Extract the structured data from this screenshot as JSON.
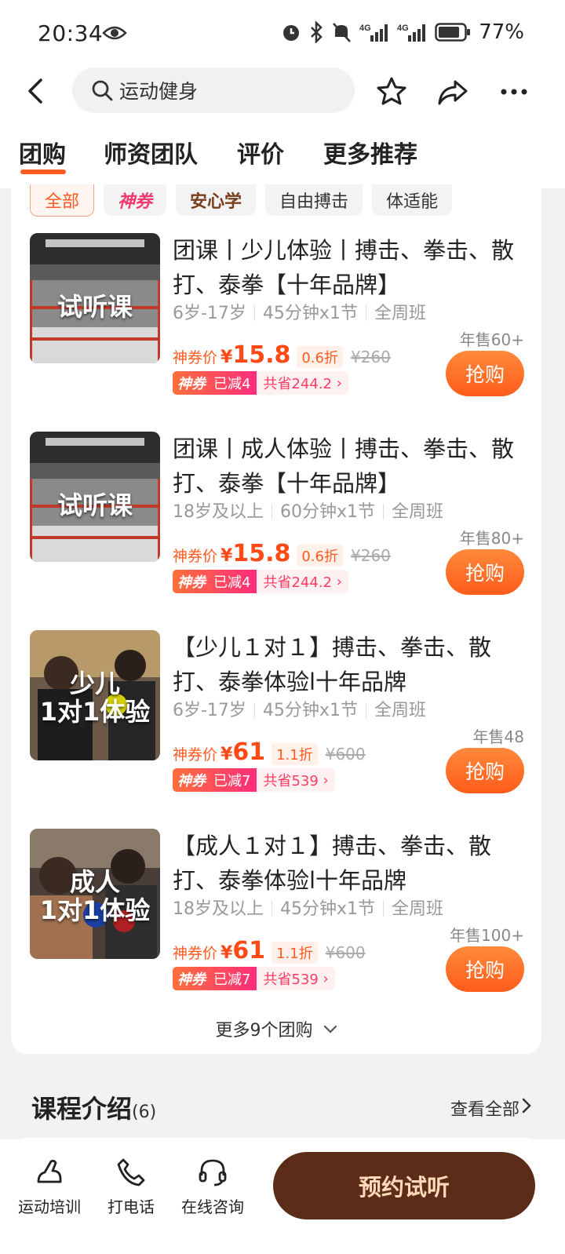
{
  "status_bar": {
    "time": "20:34",
    "battery": "77%"
  },
  "search": {
    "text": "运动健身"
  },
  "tabs": [
    "团购",
    "师资团队",
    "评价",
    "更多推荐"
  ],
  "filters": [
    "全部",
    "神券",
    "安心学",
    "自由搏击",
    "体适能"
  ],
  "deals": [
    {
      "thumb_text": "试听课",
      "title": "团课丨少儿体验丨搏击、拳击、散打、泰拳【十年品牌】",
      "meta": [
        "6岁-17岁",
        "45分钟x1节",
        "全周班"
      ],
      "sold": "年售60+",
      "price_label": "神券价",
      "price": "15.8",
      "discount": "0.6折",
      "original": "¥260",
      "promo_tag": "神券",
      "promo_reduce": "已减4",
      "promo_save": "共省244.2",
      "button": "抢购"
    },
    {
      "thumb_text": "试听课",
      "title": "团课丨成人体验丨搏击、拳击、散打、泰拳【十年品牌】",
      "meta": [
        "18岁及以上",
        "60分钟x1节",
        "全周班"
      ],
      "sold": "年售80+",
      "price_label": "神券价",
      "price": "15.8",
      "discount": "0.6折",
      "original": "¥260",
      "promo_tag": "神券",
      "promo_reduce": "已减4",
      "promo_save": "共省244.2",
      "button": "抢购"
    },
    {
      "thumb_text": "少儿\n1对1体验",
      "title": "【少儿１对１】搏击、拳击、散打、泰拳体验l十年品牌",
      "meta": [
        "6岁-17岁",
        "45分钟x1节",
        "全周班"
      ],
      "sold": "年售48",
      "price_label": "神券价",
      "price": "61",
      "discount": "1.1折",
      "original": "¥600",
      "promo_tag": "神券",
      "promo_reduce": "已减7",
      "promo_save": "共省539",
      "button": "抢购"
    },
    {
      "thumb_text": "成人\n1对1体验",
      "title": "【成人１对１】搏击、拳击、散打、泰拳体验l十年品牌",
      "meta": [
        "18岁及以上",
        "45分钟x1节",
        "全周班"
      ],
      "sold": "年售100+",
      "price_label": "神券价",
      "price": "61",
      "discount": "1.1折",
      "original": "¥600",
      "promo_tag": "神券",
      "promo_reduce": "已减7",
      "promo_save": "共省539",
      "button": "抢购"
    }
  ],
  "more_deals": "更多9个团购",
  "course": {
    "title": "课程介绍",
    "count": "(6)",
    "view_all": "查看全部"
  },
  "bottom_bar": {
    "items": [
      "运动培训",
      "打电话",
      "在线咨询"
    ],
    "cta": "预约试听"
  },
  "colors": {
    "accent": "#ff5a1f",
    "cta_bg": "#5b2c18",
    "cta_text": "#ffd9b8"
  }
}
